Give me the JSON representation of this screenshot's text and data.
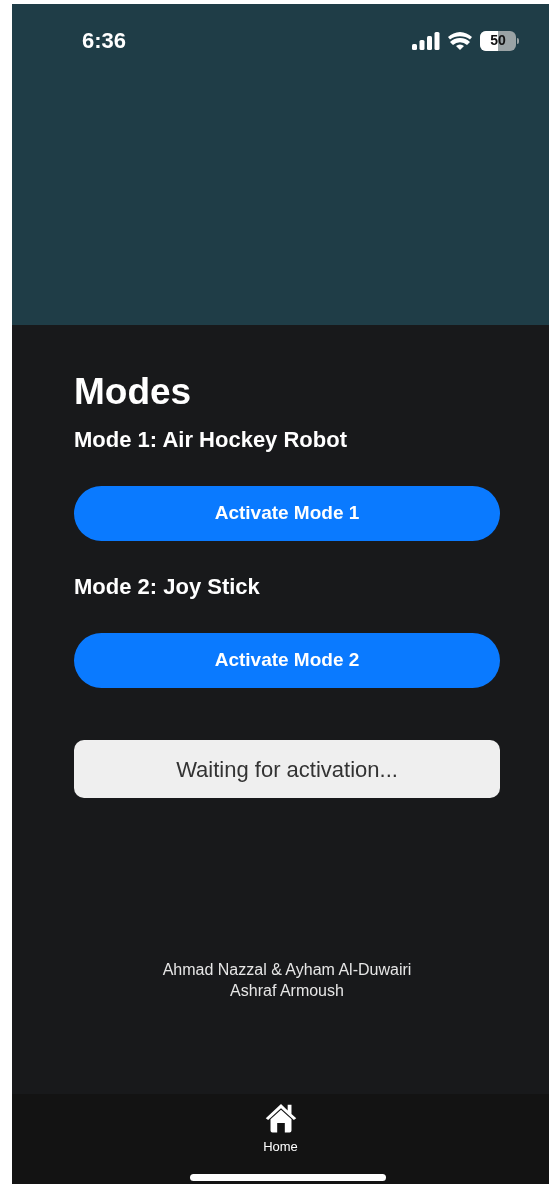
{
  "status_bar": {
    "time": "6:36",
    "battery": "50"
  },
  "title": "Modes",
  "modes": [
    {
      "label": "Mode 1: Air Hockey Robot",
      "button": "Activate Mode 1"
    },
    {
      "label": "Mode 2: Joy Stick",
      "button": "Activate Mode 2"
    }
  ],
  "status_message": "Waiting for activation...",
  "credits": [
    "Ahmad Nazzal & Ayham Al-Duwairi",
    "Ashraf Armoush"
  ],
  "tab_bar": [
    {
      "label": "Home",
      "selected": true
    }
  ]
}
